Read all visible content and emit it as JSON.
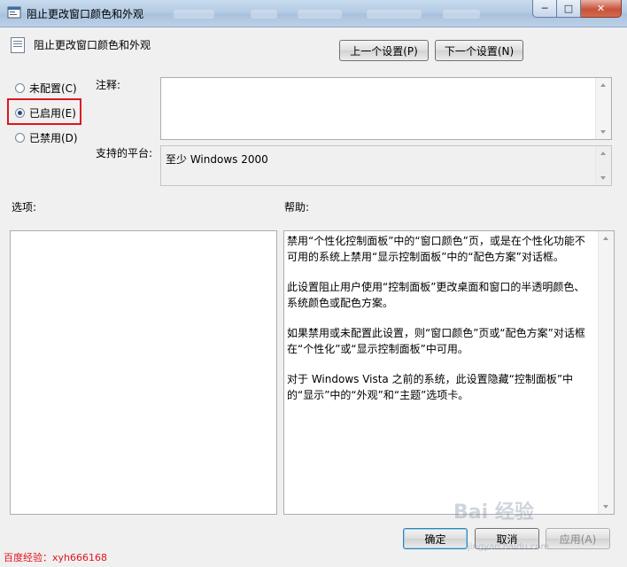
{
  "window": {
    "title": "阻止更改窗口颜色和外观"
  },
  "header": {
    "policy_name": "阻止更改窗口颜色和外观",
    "prev_button": "上一个设置(P)",
    "next_button": "下一个设置(N)"
  },
  "state": {
    "options": [
      {
        "label": "未配置(C)",
        "checked": false
      },
      {
        "label": "已启用(E)",
        "checked": true
      },
      {
        "label": "已禁用(D)",
        "checked": false
      }
    ]
  },
  "comment": {
    "label": "注释:",
    "value": ""
  },
  "platform": {
    "label": "支持的平台:",
    "value": "至少 Windows 2000"
  },
  "options_label": "选项:",
  "help": {
    "label": "帮助:",
    "paragraphs": [
      "禁用“个性化控制面板”中的“窗口颜色”页，或是在个性化功能不可用的系统上禁用“显示控制面板”中的“配色方案”对话框。",
      "此设置阻止用户使用“控制面板”更改桌面和窗口的半透明颜色、系统颜色或配色方案。",
      "如果禁用或未配置此设置，则“窗口颜色”页或“配色方案”对话框在“个性化”或“显示控制面板”中可用。",
      "对于 Windows Vista 之前的系统，此设置隐藏“控制面板”中的“显示”中的“外观”和“主题”选项卡。"
    ]
  },
  "footer": {
    "ok": "确定",
    "cancel": "取消",
    "apply": "应用(A)"
  },
  "watermark": {
    "text": "百度经验：xyh666168",
    "logo": "Bai 经验",
    "sub": "jingyan.baidu.com"
  }
}
